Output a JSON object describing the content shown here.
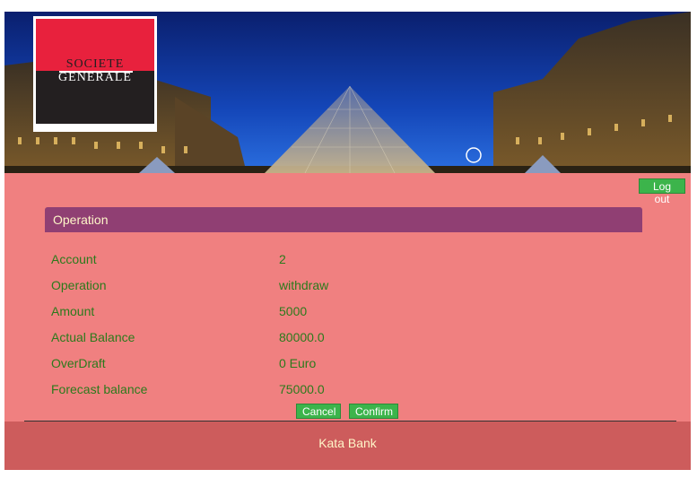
{
  "logo": {
    "line1": "SOCIETE",
    "line2": "GENERALE"
  },
  "header": {
    "logout_label": "Log out"
  },
  "panel": {
    "title": "Operation"
  },
  "details": [
    {
      "label": "Account",
      "value": "2"
    },
    {
      "label": "Operation",
      "value": "withdraw"
    },
    {
      "label": "Amount",
      "value": "5000"
    },
    {
      "label": "Actual Balance",
      "value": "80000.0"
    },
    {
      "label": "OverDraft",
      "value": "0 Euro"
    },
    {
      "label": "Forecast balance",
      "value": "75000.0"
    }
  ],
  "actions": {
    "cancel_label": "Cancel",
    "confirm_label": "Confirm"
  },
  "footer": {
    "text": "Kata Bank"
  },
  "colors": {
    "content_bg": "#f08080",
    "panel_header": "#903f73",
    "button": "#3cb44b",
    "footer_bg": "#cd5c5c",
    "text_green": "#2b7a1c",
    "text_cream": "#fff6c8"
  }
}
